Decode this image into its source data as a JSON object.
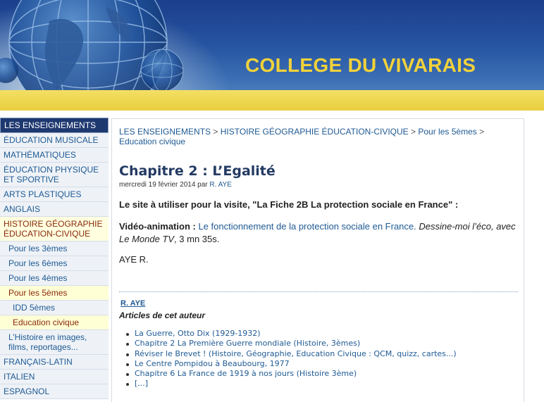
{
  "header": {
    "title": "COLLEGE DU VIVARAIS"
  },
  "sidebar": {
    "heading": "LES ENSEIGNEMENTS",
    "items": [
      "ÉDUCATION MUSICALE",
      "MATHÉMATIQUES",
      "ÉDUCATION PHYSIQUE ET SPORTIVE",
      "ARTS PLASTIQUES",
      "ANGLAIS",
      "HISTOIRE GÉOGRAPHIE ÉDUCATION-CIVIQUE",
      "Pour les 3èmes",
      "Pour les 6èmes",
      "Pour les 4èmes",
      "Pour les 5èmes",
      "IDD 5èmes",
      "Education civique",
      "L’Histoire en images, films, reportages...",
      "FRANÇAIS-LATIN",
      "ITALIEN",
      "ESPAGNOL"
    ]
  },
  "breadcrumb": {
    "items": [
      "LES ENSEIGNEMENTS",
      "HISTOIRE GÉOGRAPHIE ÉDUCATION-CIVIQUE",
      "Pour les 5èmes",
      "Education civique"
    ],
    "separator": ">"
  },
  "article": {
    "title": "Chapitre 2 : L’Egalité",
    "date": "mercredi 19 février 2014",
    "by": "par",
    "author": "R. AYE",
    "intro": "Le site à utiliser pour la visite, \"La Fiche 2B La protection sociale en France\" :",
    "video_label": "Vidéo-animation :",
    "video_link": "Le fonctionnement de la protection sociale en France.",
    "video_desc": "Dessine-moi l’éco, avec Le Monde TV",
    "video_duration": ", 3 mn 35s.",
    "signature": "AYE R."
  },
  "author_box": {
    "name": "R. AYE",
    "heading": "Articles de cet auteur",
    "articles": [
      "La Guerre, Otto Dix (1929-1932)",
      "Chapitre 2 La Première Guerre mondiale (Histoire, 3èmes)",
      "Réviser le Brevet ! (Histoire, Géographie, Education Civique : QCM, quizz, cartes...)",
      "Le Centre Pompidou à Beaubourg, 1977",
      "Chapitre 6 La France de 1919 à nos jours (Histoire 3ème)",
      "[...]"
    ]
  },
  "colors": {
    "nav_head": "#1e3870",
    "link": "#1f5a93",
    "title_yellow": "#f2d23a",
    "active_bg": "#ffffe0"
  }
}
